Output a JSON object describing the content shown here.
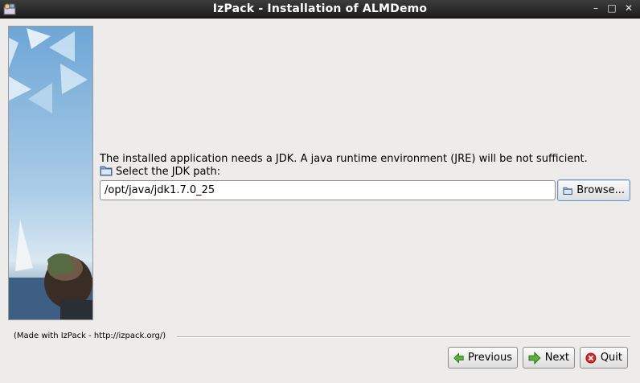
{
  "window": {
    "title": "IzPack - Installation of ALMDemo",
    "minimize_glyph": "–",
    "maximize_glyph": "□",
    "close_glyph": "✕"
  },
  "panel": {
    "message": "The installed application needs a JDK. A java runtime environment (JRE) will be not sufficient.",
    "path_label": "Select the JDK path:",
    "path_value": "/opt/java/jdk1.7.0_25",
    "browse_label": "Browse..."
  },
  "footer": {
    "credit": "(Made with IzPack - http://izpack.org/)",
    "previous_label": "Previous",
    "next_label": "Next",
    "quit_label": "Quit"
  },
  "icons": {
    "app": "izpack-app-icon",
    "folder": "folder-icon",
    "previous": "green-left-arrow-icon",
    "next": "green-right-arrow-icon",
    "quit": "red-x-icon"
  }
}
